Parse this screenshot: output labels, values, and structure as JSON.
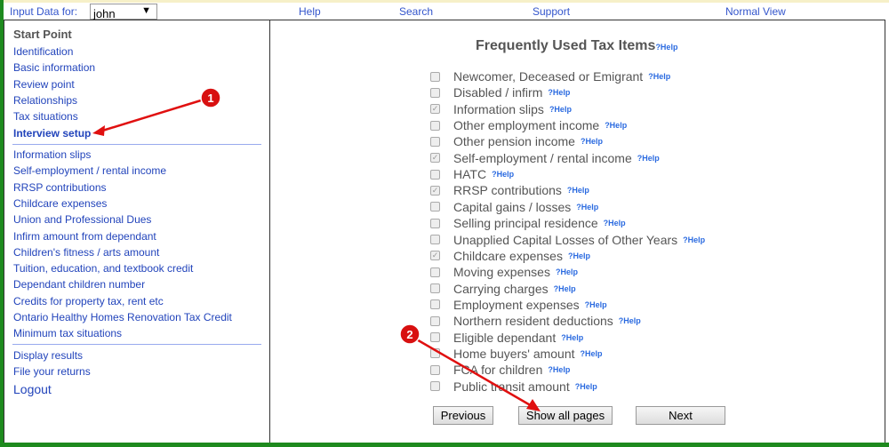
{
  "header": {
    "input_label": "Input Data for:",
    "user": "john",
    "help": "Help",
    "search": "Search",
    "support": "Support",
    "normal_view": "Normal View"
  },
  "sidebar": {
    "start": "Start Point",
    "group1": [
      "Identification",
      "Basic information",
      "Review point",
      "Relationships",
      "Tax situations",
      "Interview setup"
    ],
    "group2": [
      "Information slips",
      "Self-employment / rental income",
      "RRSP contributions",
      "Childcare expenses",
      "Union and Professional Dues",
      "Infirm amount from dependant",
      "Children's fitness / arts amount",
      "Tuition, education, and textbook credit",
      "Dependant children number",
      "Credits for property tax, rent etc",
      "Ontario Healthy Homes Renovation Tax Credit",
      "Minimum tax situations"
    ],
    "group3": [
      "Display results",
      "File your returns"
    ],
    "logout": "Logout"
  },
  "main": {
    "title": "Frequently Used Tax Items",
    "help": "?Help",
    "items": [
      {
        "label": "Newcomer, Deceased or Emigrant",
        "checked": false
      },
      {
        "label": "Disabled / infirm",
        "checked": false
      },
      {
        "label": "Information slips",
        "checked": true
      },
      {
        "label": "Other employment income",
        "checked": false
      },
      {
        "label": "Other pension income",
        "checked": false
      },
      {
        "label": "Self-employment / rental income",
        "checked": true
      },
      {
        "label": "HATC",
        "checked": false
      },
      {
        "label": "RRSP contributions",
        "checked": true
      },
      {
        "label": "Capital gains / losses",
        "checked": false
      },
      {
        "label": "Selling principal residence",
        "checked": false
      },
      {
        "label": "Unapplied Capital Losses of Other Years",
        "checked": false
      },
      {
        "label": "Childcare expenses",
        "checked": true
      },
      {
        "label": "Moving expenses",
        "checked": false
      },
      {
        "label": "Carrying charges",
        "checked": false
      },
      {
        "label": "Employment expenses",
        "checked": false
      },
      {
        "label": "Northern resident deductions",
        "checked": false
      },
      {
        "label": "Eligible dependant",
        "checked": false
      },
      {
        "label": "Home buyers' amount",
        "checked": false
      },
      {
        "label": "FCA for children",
        "checked": false
      },
      {
        "label": "Public transit amount",
        "checked": false
      }
    ],
    "previous": "Previous",
    "show_all": "Show all pages",
    "next": "Next"
  },
  "annotations": {
    "marker1": "1",
    "marker2": "2",
    "color": "#e01010"
  }
}
